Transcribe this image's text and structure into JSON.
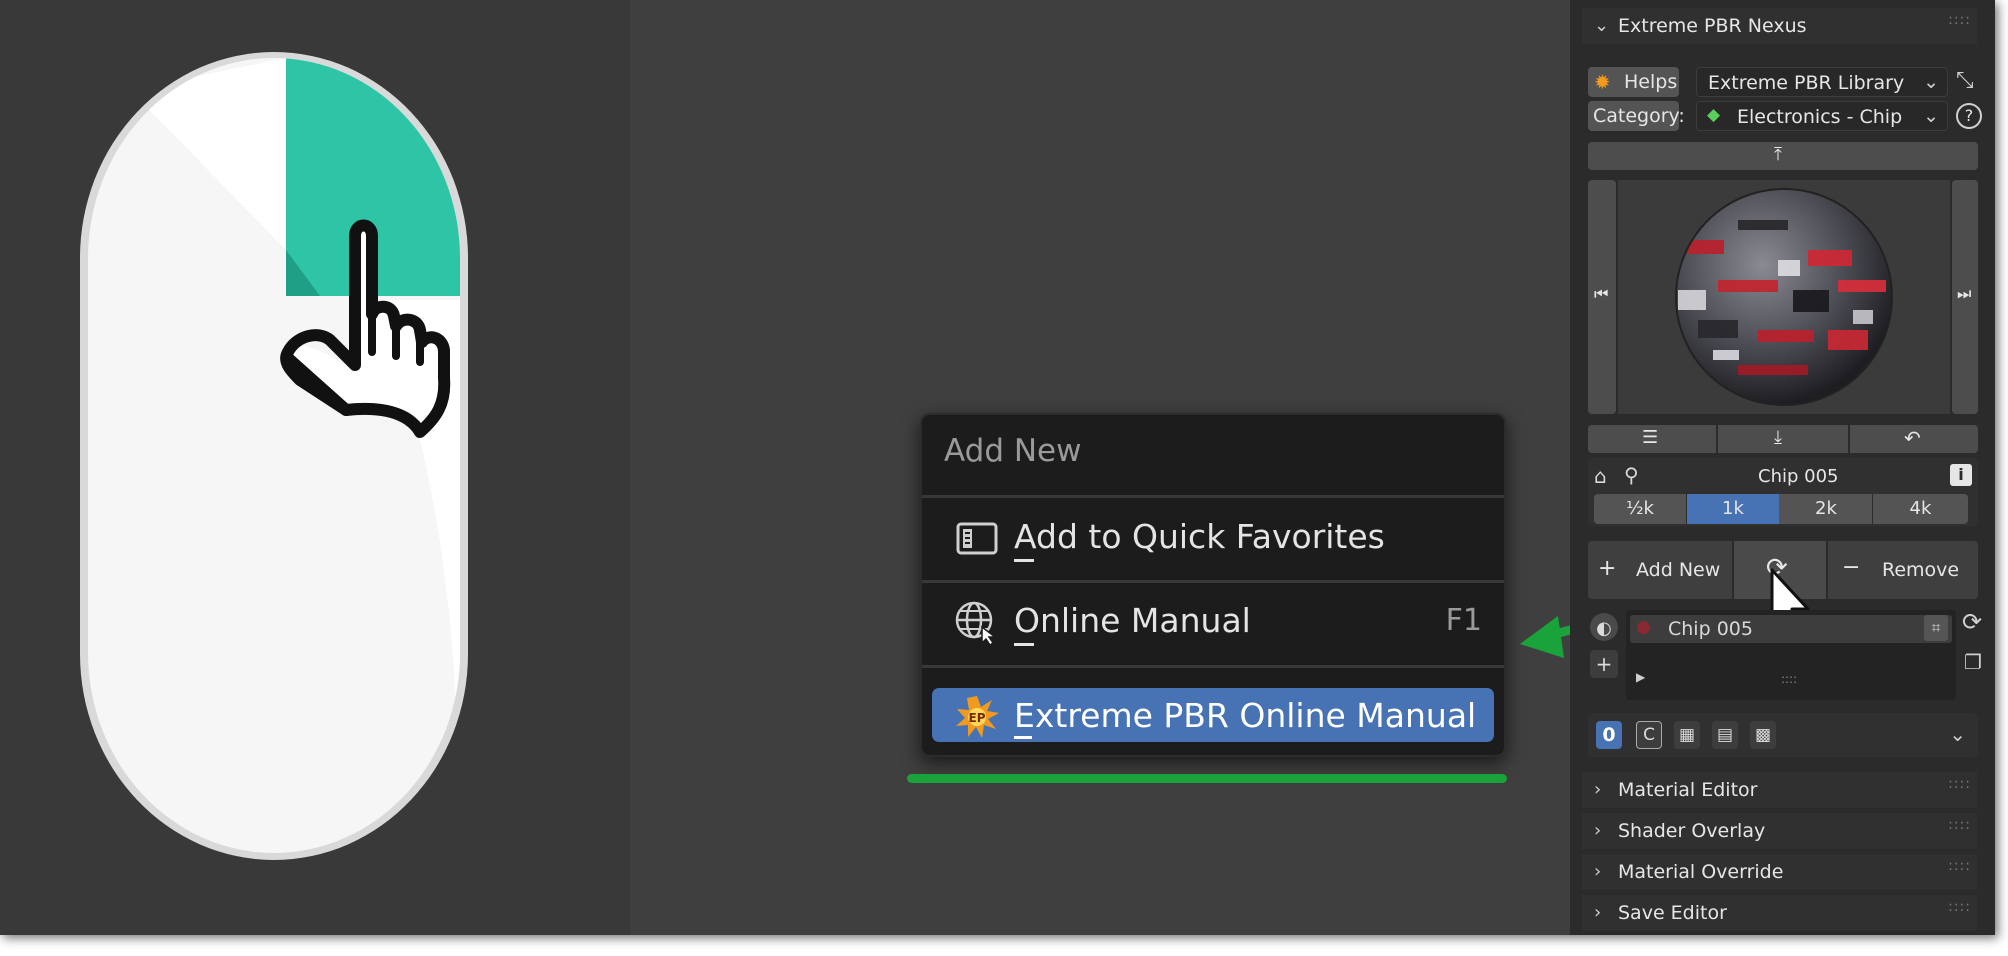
{
  "colors": {
    "accent_teal": "#2ec4a6",
    "selection_blue": "#4772b3",
    "guide_green": "#1aa33a",
    "menu_bg": "#1c1c1c",
    "panel_bg": "#2b2b2b"
  },
  "context_menu": {
    "title": "Add New",
    "items": [
      {
        "label": "Add to Quick Favorites",
        "icon": "quick-favorites-icon",
        "shortcut": ""
      },
      {
        "label": "Online Manual",
        "icon": "globe-cursor-icon",
        "shortcut": "F1"
      },
      {
        "label": "Extreme PBR Online Manual",
        "icon": "extreme-pbr-logo-icon",
        "shortcut": ""
      }
    ]
  },
  "panel": {
    "title": "Extreme PBR Nexus",
    "helps_label": "Helps",
    "library_value": "Extreme PBR Library",
    "category_label": "Category:",
    "category_value": "Electronics - Chip",
    "material_name": "Chip 005",
    "resolutions": [
      "½k",
      "1k",
      "2k",
      "4k"
    ],
    "selected_resolution": "1k",
    "add_new_label": "Add New",
    "remove_label": "Remove",
    "slot_name": "Chip 005",
    "slot_grip": "::::",
    "flag_zero": "0",
    "flag_c": "C",
    "sections": [
      "Material Editor",
      "Shader Overlay",
      "Material Override",
      "Save Editor"
    ]
  }
}
